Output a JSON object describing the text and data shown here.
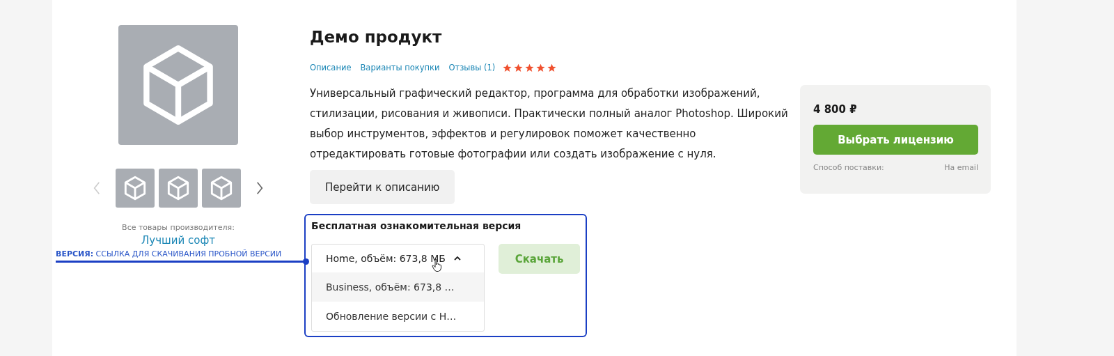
{
  "gallery": {
    "prev": {
      "disabled": true
    },
    "next": {
      "disabled": false
    },
    "thumbnails": [
      {
        "kind": "box"
      },
      {
        "kind": "box"
      },
      {
        "kind": "box"
      }
    ],
    "maker_caption": "Все товары производителя:",
    "maker_link": "Лучший софт"
  },
  "annotation": {
    "label": "**ВЕРСИЯ:** ССЫЛКА ДЛЯ СКАЧИВАНИЯ ПРОБНОЙ ВЕРСИИ"
  },
  "product": {
    "title": "Демо продукт",
    "nav": [
      {
        "label": "Описание"
      },
      {
        "label": "Варианты покупки"
      },
      {
        "label": "Отзывы (1)"
      }
    ],
    "stars": 5,
    "description": "Универсальный графический редактор, программа для обработки изображений, стилизации, рисования и живописи. Практически полный аналог Photoshop. Широкий выбор инструментов, эффектов и регулировок поможет качественно отредактировать готовые фотографии или создать изображение с нуля.",
    "description_button": "Перейти к описанию"
  },
  "trial": {
    "title": "Бесплатная ознакомительная версия",
    "select": {
      "value": "Home, объём: 673,8 МБ",
      "expanded": true
    },
    "options": [
      {
        "label": "Business, объём: 673,8 …",
        "hovered": true
      },
      {
        "label": "Обновление версии с Н…",
        "hovered": false
      }
    ],
    "button": "Скачать"
  },
  "price": {
    "amount": "4 800 ₽",
    "button": "Выбрать лицензию",
    "delivery_label": "Способ поставки:",
    "delivery_value": "На email"
  }
}
